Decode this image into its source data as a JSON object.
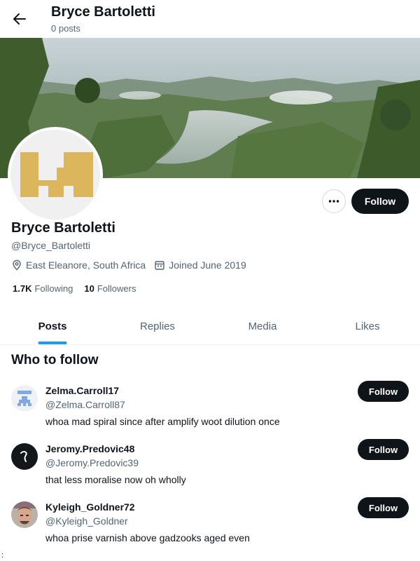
{
  "header": {
    "title": "Bryce Bartoletti",
    "subtitle": "0 posts",
    "back_icon": "arrow-left-icon"
  },
  "profile": {
    "name": "Bryce Bartoletti",
    "handle": "@Bryce_Bartoletti",
    "location": "East Eleanore, South Africa",
    "joined": "Joined June 2019",
    "following_count": "1.7K",
    "following_label": "Following",
    "followers_count": "10",
    "followers_label": "Followers",
    "follow_label": "Follow",
    "more_icon": "more-horizontal-icon"
  },
  "tabs": [
    {
      "label": "Posts",
      "active": true
    },
    {
      "label": "Replies",
      "active": false
    },
    {
      "label": "Media",
      "active": false
    },
    {
      "label": "Likes",
      "active": false
    }
  ],
  "who_to_follow": {
    "title": "Who to follow",
    "users": [
      {
        "name": "Zelma.Carroll17",
        "handle": "@Zelma.Carroll87",
        "bio": "whoa mad spiral since after amplify woot dilution once",
        "follow_label": "Follow"
      },
      {
        "name": "Jeromy.Predovic48",
        "handle": "@Jeromy.Predovic39",
        "bio": "that less moralise now oh wholly",
        "follow_label": "Follow"
      },
      {
        "name": "Kyleigh_Goldner72",
        "handle": "@Kyleigh_Goldner",
        "bio": "whoa prise varnish above gadzooks aged even",
        "follow_label": "Follow"
      }
    ]
  },
  "stray_text": ":",
  "colors": {
    "text_primary": "#0f1419",
    "text_secondary": "#536471",
    "accent": "#1d9bf0",
    "button_dark": "#0f1419",
    "avatar_gold": "#dcb65c"
  }
}
